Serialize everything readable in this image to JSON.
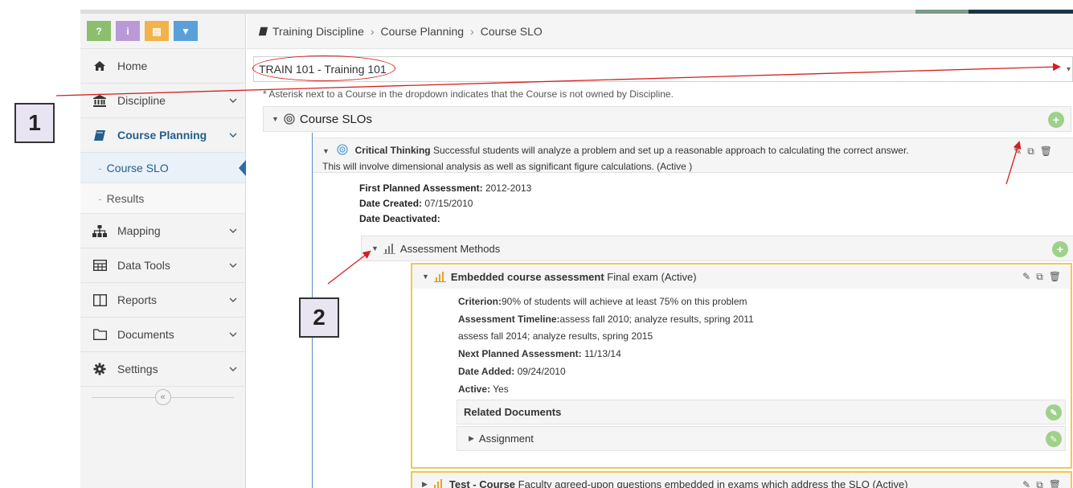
{
  "toolbar": {
    "buttons": [
      {
        "label": "?",
        "color": "#8bbf6e"
      },
      {
        "label": "i",
        "color": "#b99ad6"
      },
      {
        "label": "▤",
        "color": "#f2b24c"
      },
      {
        "label": "▼",
        "color": "#5aa0d8"
      }
    ]
  },
  "sidebar": {
    "items": [
      {
        "label": "Home",
        "icon": "home-icon",
        "chevron": ""
      },
      {
        "label": "Discipline",
        "icon": "institution-icon",
        "chevron": "⌄"
      },
      {
        "label": "Course Planning",
        "icon": "book-icon",
        "chevron": "⌄"
      },
      {
        "label": "Course SLO"
      },
      {
        "label": "Results"
      },
      {
        "label": "Mapping",
        "icon": "sitemap-icon",
        "chevron": "⌄"
      },
      {
        "label": "Data Tools",
        "icon": "table-icon",
        "chevron": "⌄"
      },
      {
        "label": "Reports",
        "icon": "columns-icon",
        "chevron": "⌄"
      },
      {
        "label": "Documents",
        "icon": "folder-icon",
        "chevron": "⌄"
      },
      {
        "label": "Settings",
        "icon": "gear-icon",
        "chevron": "⌄"
      }
    ],
    "collapse_label": "«"
  },
  "breadcrumb": {
    "items": [
      "Training Discipline",
      "Course Planning",
      "Course SLO"
    ],
    "separator": "›"
  },
  "course_select": {
    "value": "TRAIN 101 - Training 101"
  },
  "asterisk_note": "* Asterisk next to a Course in the dropdown indicates that the Course is not owned by Discipline.",
  "course_slos": {
    "label": "Course SLOs"
  },
  "critical_thinking": {
    "title": "Critical Thinking",
    "description": "Successful students will analyze a problem and set up a reasonable approach to calculating the correct answer.",
    "description2": "This will involve dimensional analysis as well as significant figure calculations. (Active )",
    "details": [
      {
        "label": "First Planned Assessment:",
        "value": " 2012-2013"
      },
      {
        "label": "Date Created:",
        "value": " 07/15/2010"
      },
      {
        "label": "Date Deactivated:",
        "value": ""
      }
    ]
  },
  "assessment_methods": {
    "label": "Assessment Methods"
  },
  "embedded": {
    "title": "Embedded course assessment",
    "subtitle": "Final exam (Active)",
    "criterion_label": "Criterion:",
    "criterion_value": "90% of students will achieve at least 75% on this problem",
    "timeline_label": "Assessment Timeline:",
    "timeline_value": "assess fall 2010; analyze results, spring 2011",
    "timeline_value2": "assess fall 2014; analyze results, spring 2015",
    "next_label": "Next Planned Assessment:",
    "next_value": " 11/13/14",
    "added_label": "Date Added:",
    "added_value": " 09/24/2010",
    "active_label": "Active:",
    "active_value": " Yes"
  },
  "related_documents": {
    "label": "Related Documents"
  },
  "assignment": {
    "label": "Assignment"
  },
  "test_course": {
    "title": "Test - Course",
    "subtitle": "Faculty agreed-upon questions embedded in exams which address the SLO (Active)"
  },
  "callouts": {
    "one": "1",
    "two": "2"
  },
  "colors": {
    "accent": "#245f8a",
    "annotation": "#d42020",
    "highlight": "#f2c94c",
    "add": "#9fd18a"
  }
}
